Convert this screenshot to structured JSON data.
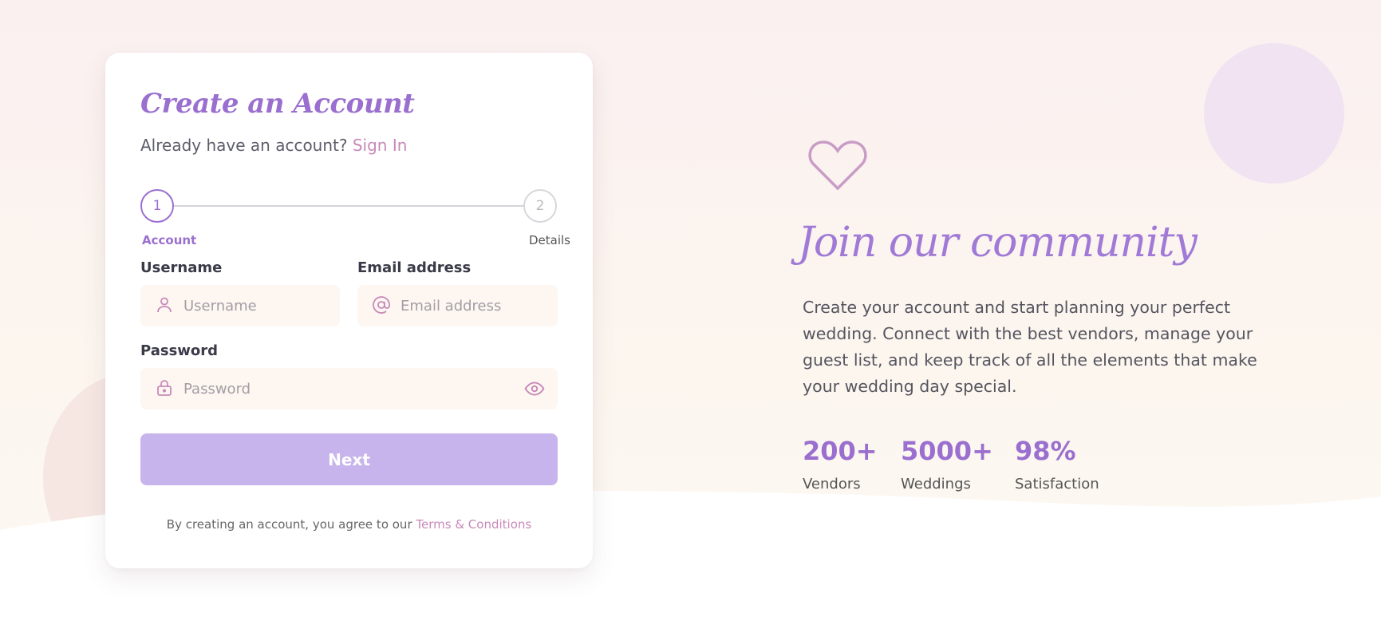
{
  "card": {
    "title": "Create an Account",
    "subtitle_text": "Already have an account?",
    "signin_link": "Sign In",
    "steps": [
      {
        "number": "1",
        "label": "Account"
      },
      {
        "number": "2",
        "label": "Details"
      }
    ],
    "fields": {
      "username": {
        "label": "Username",
        "placeholder": "Username"
      },
      "email": {
        "label": "Email address",
        "placeholder": "Email address"
      },
      "password": {
        "label": "Password",
        "placeholder": "Password"
      }
    },
    "next_label": "Next",
    "terms_text": "By creating an account, you agree to our",
    "terms_link": "Terms & Conditions"
  },
  "hero": {
    "title": "Join our community",
    "blurb": "Create your account and start planning your perfect wedding. Connect with the best vendors, manage your guest list, and keep track of all the elements that make your wedding day special.",
    "stats": [
      {
        "value": "200+",
        "label": "Vendors"
      },
      {
        "value": "5000+",
        "label": "Weddings"
      },
      {
        "value": "98%",
        "label": "Satisfaction"
      }
    ]
  },
  "colors": {
    "accent": "#9a6fcf",
    "link": "#c88ab9",
    "button": "#c8b4ec"
  }
}
